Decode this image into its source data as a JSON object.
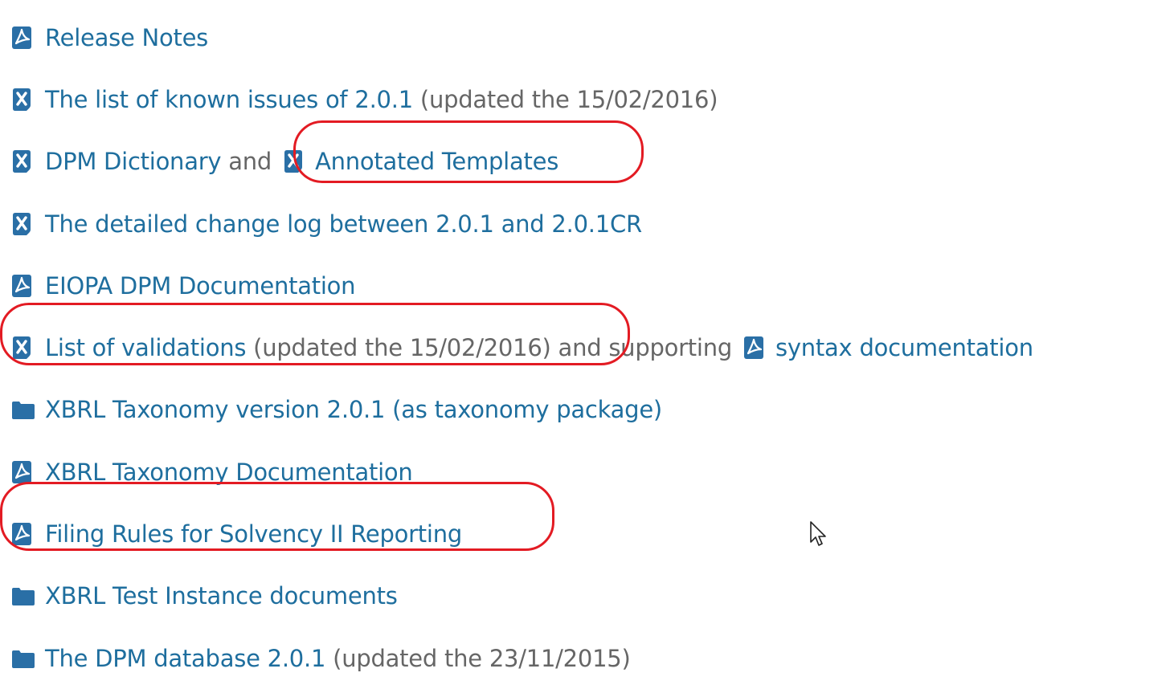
{
  "items": [
    {
      "icon": "pdf-icon",
      "segments": [
        {
          "type": "link",
          "text": "Release Notes"
        }
      ]
    },
    {
      "icon": "excel-icon",
      "segments": [
        {
          "type": "link",
          "text": "The list of known issues of 2.0.1"
        },
        {
          "type": "text",
          "text": " (updated the 15/02/2016)"
        }
      ]
    },
    {
      "icon": "excel-icon",
      "segments": [
        {
          "type": "link",
          "text": "DPM Dictionary"
        },
        {
          "type": "text",
          "text": " and"
        },
        {
          "type": "icon",
          "icon": "excel-icon"
        },
        {
          "type": "link",
          "text": "Annotated Templates"
        }
      ]
    },
    {
      "icon": "excel-icon",
      "segments": [
        {
          "type": "link",
          "text": "The detailed change log between 2.0.1 and 2.0.1CR"
        }
      ]
    },
    {
      "icon": "pdf-icon",
      "segments": [
        {
          "type": "link",
          "text": "EIOPA DPM Documentation"
        }
      ]
    },
    {
      "icon": "excel-icon",
      "segments": [
        {
          "type": "link",
          "text": "List of validations"
        },
        {
          "type": "text",
          "text": " (updated the 15/02/2016) and supporting"
        },
        {
          "type": "icon",
          "icon": "pdf-icon"
        },
        {
          "type": "link",
          "text": "syntax documentation"
        }
      ]
    },
    {
      "icon": "folder-icon",
      "segments": [
        {
          "type": "link",
          "text": "XBRL Taxonomy version 2.0.1 (as taxonomy package)"
        }
      ]
    },
    {
      "icon": "pdf-icon",
      "segments": [
        {
          "type": "link",
          "text": "XBRL Taxonomy Documentation"
        }
      ]
    },
    {
      "icon": "pdf-icon",
      "segments": [
        {
          "type": "link",
          "text": "Filing Rules for Solvency II Reporting"
        }
      ]
    },
    {
      "icon": "folder-icon",
      "segments": [
        {
          "type": "link",
          "text": "XBRL Test Instance documents"
        }
      ]
    },
    {
      "icon": "folder-icon",
      "segments": [
        {
          "type": "link",
          "text": "The DPM database 2.0.1"
        },
        {
          "type": "text",
          "text": " (updated the 23/11/2015)"
        }
      ]
    }
  ],
  "colors": {
    "link": "#1e6e9e",
    "text": "#666666",
    "icon": "#2a6fa6",
    "annotation": "#e31b23"
  }
}
